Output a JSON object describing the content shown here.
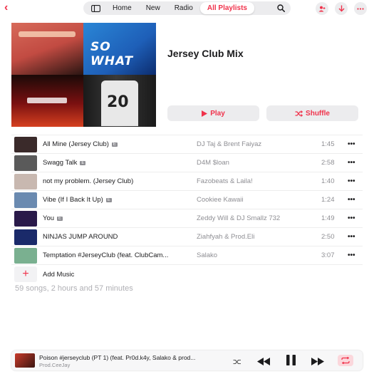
{
  "nav": {
    "back_icon": "chevron-left-icon",
    "tabs": [
      {
        "label": "Home"
      },
      {
        "label": "New"
      },
      {
        "label": "Radio"
      },
      {
        "label": "All Playlists",
        "active": true
      }
    ],
    "sidebar_icon": "sidebar-icon",
    "search_icon": "search-icon",
    "right_icons": [
      "add-person-icon",
      "download-icon",
      "more-icon"
    ]
  },
  "playlist": {
    "title": "Jersey Club Mix",
    "cover_text": {
      "so_what": "SO WHAT",
      "jersey_number": "20"
    },
    "play_label": "Play",
    "shuffle_label": "Shuffle"
  },
  "tracks": [
    {
      "title": "All Mine (Jersey Club)",
      "explicit": true,
      "artist": "DJ Taj & Brent Faiyaz",
      "duration": "1:45",
      "art_color": "#3a2a2a"
    },
    {
      "title": "Swagg Talk",
      "explicit": true,
      "artist": "D4M $loan",
      "duration": "2:58",
      "art_color": "#5a5a5a"
    },
    {
      "title": "not my problem. (Jersey Club)",
      "explicit": false,
      "artist": "Fazobeats & Laila!",
      "duration": "1:40",
      "art_color": "#c8b8b0"
    },
    {
      "title": "Vibe (If I Back It Up)",
      "explicit": true,
      "artist": "Cookiee Kawaii",
      "duration": "1:24",
      "art_color": "#6a8ab0"
    },
    {
      "title": "You",
      "explicit": true,
      "artist": "Zeddy Will & DJ Smallz 732",
      "duration": "1:49",
      "art_color": "#2a1a4a"
    },
    {
      "title": "NINJAS JUMP AROUND",
      "explicit": false,
      "artist": "Ziahfyah & Prod.Eli",
      "duration": "2:50",
      "art_color": "#1a2a6a"
    },
    {
      "title": "Temptation #JerseyClub (feat. ClubCam...",
      "explicit": false,
      "artist": "Salako",
      "duration": "3:07",
      "art_color": "#7ab090"
    }
  ],
  "explicit_badge": "E",
  "add_music_label": "Add Music",
  "summary": "59 songs, 2 hours and 57 minutes",
  "now_playing": {
    "title": "Poison #jerseyclub (PT 1) (feat. Pr0d.k4y, Salako & prod...",
    "artist": "Prod.CeeJay",
    "controls": [
      "shuffle-icon",
      "rewind-icon",
      "pause-icon",
      "fast-forward-icon",
      "repeat-icon"
    ]
  },
  "colors": {
    "accent": "#f0324b",
    "secondary_text": "#8e8e93"
  }
}
